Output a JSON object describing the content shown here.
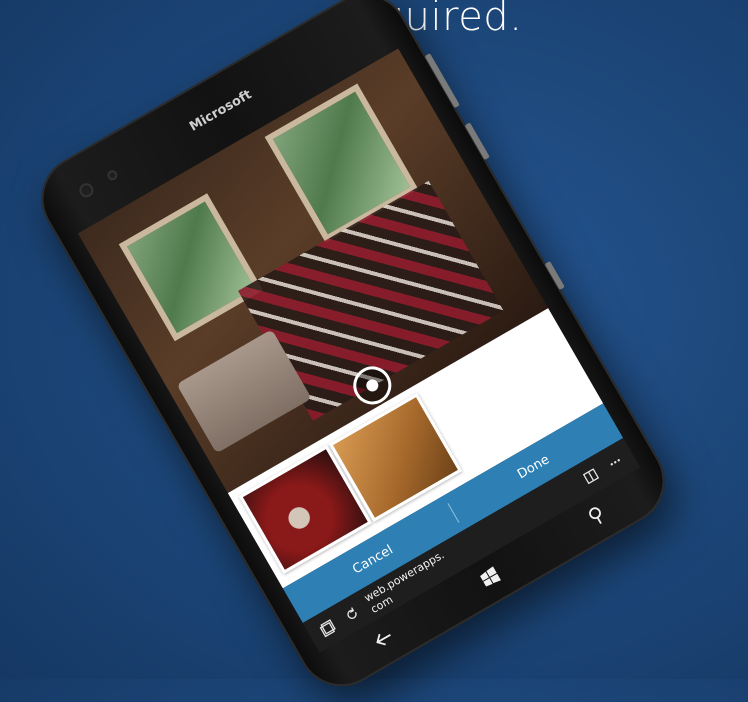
{
  "caption": {
    "text": "required."
  },
  "device": {
    "brand": "Microsoft"
  },
  "camera": {
    "capture_icon": "capture-icon"
  },
  "photo_tray": {
    "thumbnails": [
      {
        "icon": "thumbnail-red-room"
      },
      {
        "icon": "thumbnail-orange-sign"
      }
    ]
  },
  "actions": {
    "cancel_label": "Cancel",
    "done_label": "Done"
  },
  "browser": {
    "address_line1": "web.powerapps.",
    "address_line2": "com",
    "icons": [
      "tabs-icon",
      "refresh-icon",
      "reading-view-icon",
      "more-icon"
    ]
  },
  "navigation": {
    "icons": [
      "back-icon",
      "windows-start-icon",
      "search-icon"
    ]
  },
  "colors": {
    "background": "#1c4678",
    "accent": "#2d7fb4",
    "phone_body": "#121212"
  }
}
